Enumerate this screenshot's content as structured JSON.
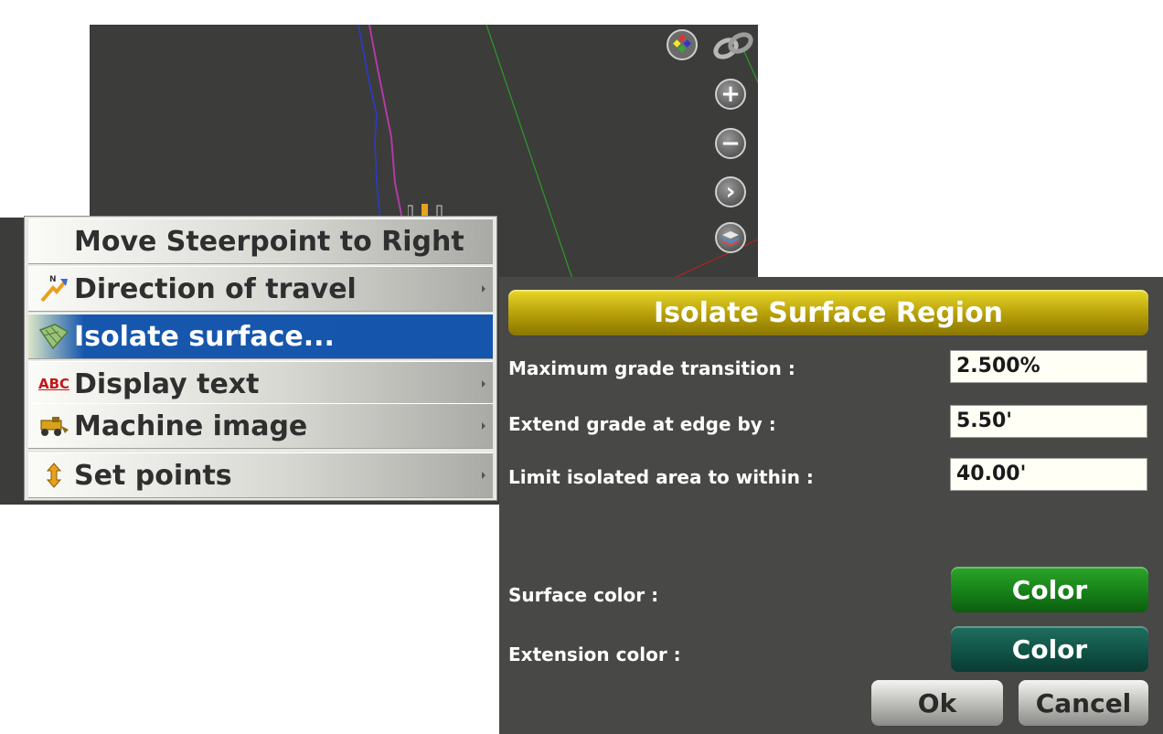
{
  "map": {
    "top_icons": [
      "overlay-grid-icon",
      "link-icon"
    ],
    "side_buttons": [
      {
        "name": "zoom-in-icon",
        "glyph": "+"
      },
      {
        "name": "zoom-out-icon",
        "glyph": "−"
      },
      {
        "name": "next-icon",
        "glyph": "›"
      },
      {
        "name": "layers-icon",
        "glyph": ""
      }
    ]
  },
  "context_menu": {
    "items": [
      {
        "label": "Move Steerpoint to Right",
        "icon": "",
        "submenu": false,
        "selected": false
      },
      {
        "label": "Direction of travel",
        "icon": "compass-arrow-icon",
        "submenu": true,
        "selected": false
      },
      {
        "label": "Isolate surface...",
        "icon": "surface-icon",
        "submenu": false,
        "selected": true
      },
      {
        "label": "Display text",
        "icon": "abc-text-icon",
        "icon_text": "ABC",
        "submenu": true,
        "selected": false
      },
      {
        "label": "Machine image",
        "icon": "machine-icon",
        "submenu": true,
        "selected": false
      },
      {
        "label": "Set points",
        "icon": "up-down-arrow-icon",
        "submenu": true,
        "selected": false
      }
    ]
  },
  "dialog": {
    "title": "Isolate Surface Region",
    "fields": [
      {
        "label": "Maximum grade transition :",
        "value": "2.500%"
      },
      {
        "label": "Extend grade at edge by :",
        "value": "5.50'"
      },
      {
        "label": "Limit isolated area to within :",
        "value": "40.00'"
      }
    ],
    "colors": [
      {
        "label": "Surface color :",
        "button": "Color",
        "color": "#1a8a1c"
      },
      {
        "label": "Extension color :",
        "button": "Color",
        "color": "#0f5145"
      }
    ],
    "ok_label": "Ok",
    "cancel_label": "Cancel"
  },
  "colors": {
    "title_bar": "#c2a90f",
    "menu_selected": "#1555ab",
    "map_background": "#3c3c3a",
    "dialog_background": "#484846"
  }
}
